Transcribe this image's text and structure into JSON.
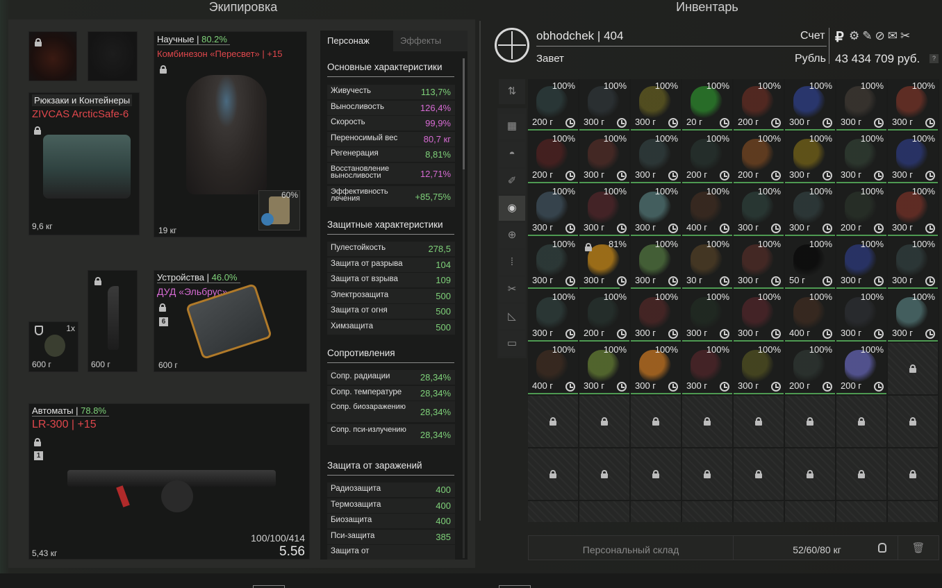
{
  "titles": {
    "equipment": "Экипировка",
    "inventory": "Инвентарь"
  },
  "equipment": {
    "backpack": {
      "category": "Рюкзаки и Контейнеры",
      "name": "ZIVCAS ArcticSafe-6",
      "weight": "9,6 кг"
    },
    "armor": {
      "category": "Научные",
      "sep": " | ",
      "durability": "80.2%",
      "name": "Комбинезон «Пересвет» | +15",
      "weight": "19 кг",
      "plate_pct": "60%"
    },
    "grenade": {
      "count": "1x",
      "weight": "600 г"
    },
    "knife": {
      "weight": "600 г"
    },
    "device": {
      "category": "Устройства",
      "sep": " | ",
      "durability": "46.0%",
      "name": "ДУД «Эльбрус»",
      "level": "6",
      "weight": "600 г"
    },
    "weapon": {
      "category": "Автоматы",
      "sep": " | ",
      "durability": "78.8%",
      "name": "LR-300 | +15",
      "level": "1",
      "ammo": "100/100/414",
      "dps": "5.56",
      "weight": "5,43 кг"
    }
  },
  "stats": {
    "tabs": [
      "Персонаж",
      "Эффекты"
    ],
    "sections": {
      "basic": "Основные характеристики",
      "protect": "Защитные характеристики",
      "resist": "Сопротивления",
      "infect": "Защита от заражений"
    },
    "basic": [
      {
        "k": "Живучесть",
        "v": "113,7%",
        "c": "green"
      },
      {
        "k": "Выносливость",
        "v": "126,4%",
        "c": "pink"
      },
      {
        "k": "Скорость",
        "v": "99,9%",
        "c": "pink"
      },
      {
        "k": "Переносимый вес",
        "v": "80,7 кг",
        "c": "pink"
      },
      {
        "k": "Регенерация",
        "v": "8,81%",
        "c": "green"
      },
      {
        "k": "Восстановление выносливости",
        "v": "12,71%",
        "c": "pink"
      },
      {
        "k": "Эффективность лечения",
        "v": "+85,75%",
        "c": "green"
      }
    ],
    "protect": [
      {
        "k": "Пулестойкость",
        "v": "278,5"
      },
      {
        "k": "Защита от разрыва",
        "v": "104"
      },
      {
        "k": "Защита от взрыва",
        "v": "109"
      },
      {
        "k": "Электрозащита",
        "v": "500"
      },
      {
        "k": "Защита от огня",
        "v": "500"
      },
      {
        "k": "Химзащита",
        "v": "500"
      }
    ],
    "resist": [
      {
        "k": "Сопр. радиации",
        "v": "28,34%"
      },
      {
        "k": "Сопр. температуре",
        "v": "28,34%"
      },
      {
        "k": "Сопр. биозаражению",
        "v": "28,34%"
      },
      {
        "k": "Сопр. пси-излучению",
        "v": "28,34%"
      }
    ],
    "infect": [
      {
        "k": "Радиозащита",
        "v": "400"
      },
      {
        "k": "Термозащита",
        "v": "400"
      },
      {
        "k": "Биозащита",
        "v": "400"
      },
      {
        "k": "Пси-защита",
        "v": "385"
      },
      {
        "k": "Защита от",
        "v": ""
      }
    ]
  },
  "player": {
    "name": "obhodchek",
    "sep": "|",
    "level": "404",
    "faction": "Завет",
    "account_label": "Счет",
    "currency_label": "Рубль",
    "balance": "43 434 709 руб."
  },
  "inventory": {
    "rows": [
      [
        {
          "p": "100%",
          "w": "200 г",
          "c": "#2b3a3a"
        },
        {
          "p": "100%",
          "w": "300 г",
          "c": "#2c3235"
        },
        {
          "p": "100%",
          "w": "300 г",
          "c": "#5a5520"
        },
        {
          "p": "100%",
          "w": "20 г",
          "c": "#2a7a2a"
        },
        {
          "p": "100%",
          "w": "200 г",
          "c": "#5a2a22"
        },
        {
          "p": "100%",
          "w": "300 г",
          "c": "#2b3a7a"
        },
        {
          "p": "100%",
          "w": "300 г",
          "c": "#3a3530"
        },
        {
          "p": "100%",
          "w": "300 г",
          "c": "#6a3026"
        }
      ],
      [
        {
          "p": "100%",
          "w": "200 г",
          "c": "#4a2020"
        },
        {
          "p": "100%",
          "w": "300 г",
          "c": "#4a2a26"
        },
        {
          "p": "100%",
          "w": "300 г",
          "c": "#2e3a3a"
        },
        {
          "p": "100%",
          "w": "200 г",
          "c": "#25302c"
        },
        {
          "p": "100%",
          "w": "200 г",
          "c": "#6a4020"
        },
        {
          "p": "100%",
          "w": "300 г",
          "c": "#6a5a18"
        },
        {
          "p": "100%",
          "w": "300 г",
          "c": "#2e3a30"
        },
        {
          "p": "100%",
          "w": "300 г",
          "c": "#2a3670"
        }
      ],
      [
        {
          "p": "100%",
          "w": "300 г",
          "c": "#3a4a55"
        },
        {
          "p": "100%",
          "w": "300 г",
          "c": "#4a2428"
        },
        {
          "p": "100%",
          "w": "300 г",
          "c": "#4a6a6a"
        },
        {
          "p": "100%",
          "w": "400 г",
          "c": "#3a2a20"
        },
        {
          "p": "100%",
          "w": "300 г",
          "c": "#2a3a36"
        },
        {
          "p": "100%",
          "w": "300 г",
          "c": "#2e3a3a"
        },
        {
          "p": "100%",
          "w": "200 г",
          "c": "#283028"
        },
        {
          "p": "100%",
          "w": "300 г",
          "c": "#6a2e26"
        }
      ],
      [
        {
          "p": "100%",
          "w": "300 г",
          "c": "#2e3c3a"
        },
        {
          "p": "81%",
          "w": "300 г",
          "c": "#b07a18",
          "lock": true
        },
        {
          "p": "100%",
          "w": "300 г",
          "c": "#4a6a3a"
        },
        {
          "p": "100%",
          "w": "30 г",
          "c": "#4a3a24"
        },
        {
          "p": "100%",
          "w": "300 г",
          "c": "#4a2a26"
        },
        {
          "p": "100%",
          "w": "50 г",
          "c": "#0c0c0c"
        },
        {
          "p": "100%",
          "w": "300 г",
          "c": "#2a3670"
        },
        {
          "p": "100%",
          "w": "300 г",
          "c": "#2e3a3a"
        }
      ],
      [
        {
          "p": "100%",
          "w": "300 г",
          "c": "#2c3a38"
        },
        {
          "p": "100%",
          "w": "200 г",
          "c": "#25302c"
        },
        {
          "p": "100%",
          "w": "300 г",
          "c": "#4a2626"
        },
        {
          "p": "100%",
          "w": "300 г",
          "c": "#202a22"
        },
        {
          "p": "100%",
          "w": "300 г",
          "c": "#4a2428"
        },
        {
          "p": "100%",
          "w": "400 г",
          "c": "#3a2a20"
        },
        {
          "p": "100%",
          "w": "300 г",
          "c": "#2a2c30"
        },
        {
          "p": "100%",
          "w": "300 г",
          "c": "#4a6a6a"
        }
      ],
      [
        {
          "p": "100%",
          "w": "400 г",
          "c": "#3a2a20"
        },
        {
          "p": "100%",
          "w": "300 г",
          "c": "#5a7030"
        },
        {
          "p": "100%",
          "w": "300 г",
          "c": "#b06a20"
        },
        {
          "p": "100%",
          "w": "300 г",
          "c": "#4a2428"
        },
        {
          "p": "100%",
          "w": "300 г",
          "c": "#4a4a20"
        },
        {
          "p": "100%",
          "w": "200 г",
          "c": "#2c3430"
        },
        {
          "p": "100%",
          "w": "200 г",
          "c": "#5a5aa0"
        },
        {
          "locked": true
        }
      ]
    ],
    "storage_label": "Персональный склад",
    "weight": "52/60/80 кг"
  },
  "colors": {
    "accent_green": "#7fd27a",
    "accent_red": "#e0474c",
    "accent_pink": "#d76bd4"
  }
}
